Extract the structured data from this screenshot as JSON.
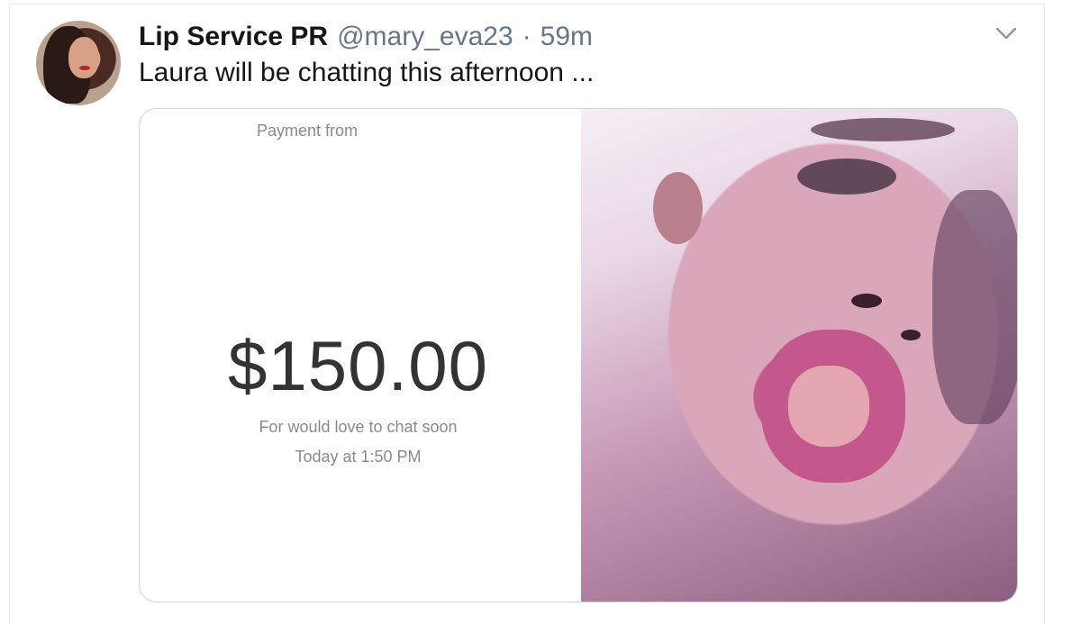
{
  "tweet": {
    "display_name": "Lip Service PR",
    "handle": "@mary_eva23",
    "separator": "·",
    "time": "59m",
    "text": "Laura will be chatting this afternoon ..."
  },
  "payment": {
    "label": "Payment from",
    "amount": "$150.00",
    "note": "For would love to chat soon",
    "date": "Today at 1:50 PM"
  },
  "icons": {
    "menu": "chevron-down-icon"
  },
  "colors": {
    "name": "#14171a",
    "secondary": "#657786",
    "border": "#ccd6dd",
    "receipt_text": "#8a8a8a",
    "amount": "#333333"
  }
}
